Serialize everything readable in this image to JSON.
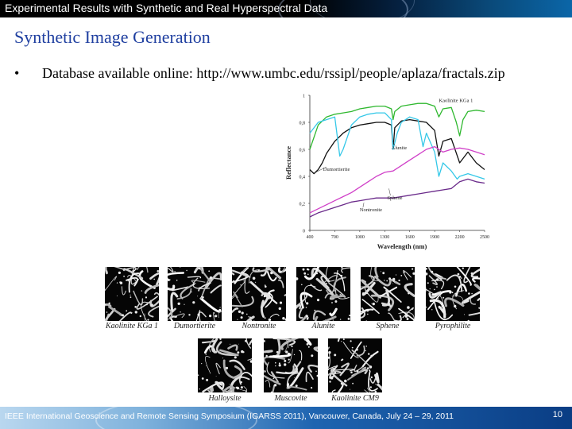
{
  "header": {
    "title": "Experimental Results with Synthetic and Real Hyperspectral Data"
  },
  "slide": {
    "title": "Synthetic Image Generation",
    "bullet_symbol": "•",
    "bullet_text": "Database available online: http://www.umbc.edu/rssipl/people/aplaza/fractals.zip"
  },
  "chart_data": {
    "type": "line",
    "xlabel": "Wavelength (nm)",
    "ylabel": "Reflectance",
    "xlim": [
      400,
      2500
    ],
    "ylim": [
      0,
      1
    ],
    "x_ticks": [
      "400",
      "700",
      "1000",
      "1300",
      "1600",
      "1900",
      "2200",
      "2500"
    ],
    "y_ticks": [
      "0",
      "0,2",
      "0,4",
      "0,6",
      "0,8",
      "1"
    ],
    "grid": false,
    "series": [
      {
        "name": "Kaolinite KGa 1",
        "color": "#2fb82f",
        "x": [
          400,
          500,
          600,
          700,
          800,
          900,
          1000,
          1100,
          1200,
          1300,
          1380,
          1400,
          1420,
          1500,
          1600,
          1700,
          1800,
          1900,
          1950,
          2000,
          2100,
          2160,
          2200,
          2240,
          2300,
          2400,
          2500
        ],
        "y": [
          0.6,
          0.78,
          0.84,
          0.86,
          0.87,
          0.88,
          0.9,
          0.91,
          0.92,
          0.92,
          0.9,
          0.82,
          0.88,
          0.92,
          0.93,
          0.94,
          0.94,
          0.92,
          0.84,
          0.9,
          0.91,
          0.8,
          0.7,
          0.82,
          0.88,
          0.89,
          0.88
        ]
      },
      {
        "name": "Dumortierite",
        "color": "#111111",
        "x": [
          400,
          450,
          500,
          550,
          600,
          700,
          800,
          900,
          1000,
          1100,
          1200,
          1300,
          1380,
          1400,
          1420,
          1500,
          1600,
          1700,
          1800,
          1900,
          1950,
          2000,
          2100,
          2200,
          2300,
          2400,
          2500
        ],
        "y": [
          0.45,
          0.42,
          0.45,
          0.5,
          0.57,
          0.66,
          0.72,
          0.76,
          0.78,
          0.79,
          0.8,
          0.8,
          0.78,
          0.6,
          0.76,
          0.81,
          0.82,
          0.81,
          0.8,
          0.74,
          0.55,
          0.66,
          0.68,
          0.5,
          0.58,
          0.5,
          0.45
        ]
      },
      {
        "name": "Alunite",
        "color": "#35c8e8",
        "x": [
          400,
          500,
          600,
          700,
          760,
          800,
          900,
          1000,
          1100,
          1200,
          1300,
          1380,
          1400,
          1450,
          1500,
          1600,
          1700,
          1760,
          1800,
          1900,
          1950,
          2000,
          2100,
          2170,
          2200,
          2300,
          2400,
          2500
        ],
        "y": [
          0.72,
          0.8,
          0.82,
          0.84,
          0.55,
          0.6,
          0.78,
          0.84,
          0.86,
          0.87,
          0.87,
          0.82,
          0.6,
          0.72,
          0.8,
          0.84,
          0.82,
          0.62,
          0.72,
          0.58,
          0.4,
          0.5,
          0.44,
          0.38,
          0.4,
          0.42,
          0.4,
          0.38
        ]
      },
      {
        "name": "Sphene",
        "color": "#d040c8",
        "x": [
          400,
          500,
          600,
          700,
          800,
          900,
          1000,
          1100,
          1200,
          1300,
          1400,
          1500,
          1600,
          1700,
          1800,
          1900,
          2000,
          2100,
          2200,
          2300,
          2400,
          2500
        ],
        "y": [
          0.13,
          0.16,
          0.19,
          0.22,
          0.25,
          0.28,
          0.32,
          0.36,
          0.4,
          0.43,
          0.44,
          0.48,
          0.52,
          0.56,
          0.6,
          0.62,
          0.58,
          0.6,
          0.61,
          0.6,
          0.58,
          0.56
        ]
      },
      {
        "name": "Nontronite",
        "color": "#6a2a8a",
        "x": [
          400,
          500,
          600,
          700,
          800,
          900,
          1000,
          1100,
          1200,
          1300,
          1400,
          1500,
          1600,
          1700,
          1800,
          1900,
          2000,
          2100,
          2200,
          2300,
          2400,
          2500
        ],
        "y": [
          0.1,
          0.13,
          0.15,
          0.17,
          0.19,
          0.21,
          0.22,
          0.23,
          0.24,
          0.24,
          0.24,
          0.25,
          0.26,
          0.27,
          0.28,
          0.29,
          0.3,
          0.31,
          0.36,
          0.38,
          0.36,
          0.35
        ]
      }
    ],
    "annotations": [
      "Kaolinite KGa 1",
      "Alunite",
      "Dumortierite",
      "Sphene",
      "Nontronite"
    ]
  },
  "thumbnails": [
    {
      "label": "Kaolinite KGa 1"
    },
    {
      "label": "Dumortierite"
    },
    {
      "label": "Nontronite"
    },
    {
      "label": "Alunite"
    },
    {
      "label": "Sphene"
    },
    {
      "label": "Pyrophilite"
    },
    {
      "label": "Halloysite"
    },
    {
      "label": "Muscovite"
    },
    {
      "label": "Kaolinite CM9"
    }
  ],
  "footer": {
    "text": "IEEE International Geoscience and Remote Sensing Symposium (IGARSS 2011), Vancouver, Canada, July 24 – 29, 2011",
    "page": "10"
  }
}
